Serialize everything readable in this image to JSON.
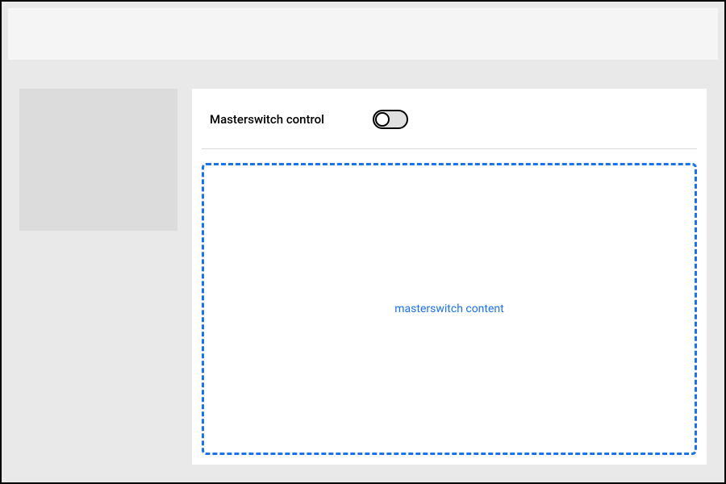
{
  "masterswitch": {
    "label": "Masterswitch control",
    "content_placeholder": "masterswitch content",
    "state": "off"
  },
  "colors": {
    "accent": "#1a73e8",
    "page_bg": "#e9e9e9",
    "block_bg": "#dcdcdc",
    "panel_bg": "#ffffff"
  }
}
